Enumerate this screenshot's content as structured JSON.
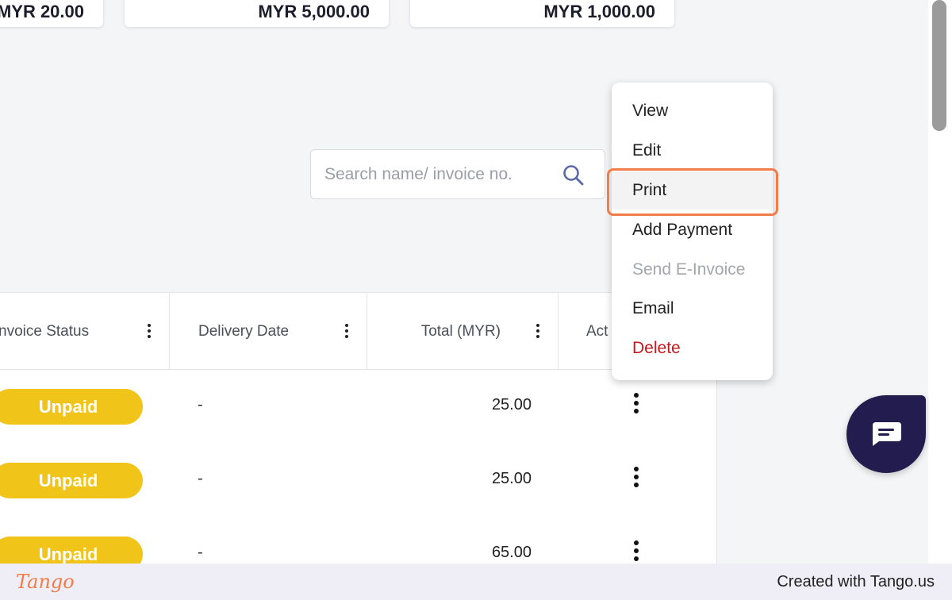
{
  "summary_cards": [
    {
      "amount": "MYR 20.00"
    },
    {
      "amount": "MYR 5,000.00"
    },
    {
      "amount": "MYR 1,000.00"
    }
  ],
  "search": {
    "placeholder": "Search name/ invoice no."
  },
  "table": {
    "columns": [
      {
        "label": "nvoice Status"
      },
      {
        "label": "Delivery Date"
      },
      {
        "label": "Total (MYR)"
      },
      {
        "label": "Act"
      }
    ],
    "rows": [
      {
        "status": "Unpaid",
        "delivery_date": "-",
        "total": "25.00"
      },
      {
        "status": "Unpaid",
        "delivery_date": "-",
        "total": "25.00"
      },
      {
        "status": "Unpaid",
        "delivery_date": "-",
        "total": "65.00"
      }
    ]
  },
  "context_menu": {
    "items": [
      {
        "label": "View",
        "state": "normal"
      },
      {
        "label": "Edit",
        "state": "normal"
      },
      {
        "label": "Print",
        "state": "highlighted"
      },
      {
        "label": "Add Payment",
        "state": "normal"
      },
      {
        "label": "Send E-Invoice",
        "state": "disabled"
      },
      {
        "label": "Email",
        "state": "normal"
      },
      {
        "label": "Delete",
        "state": "danger"
      }
    ]
  },
  "colors": {
    "status_unpaid": "#f0c419",
    "highlight_ring": "#f07d4a",
    "danger": "#c8171d",
    "chat_button": "#221c4f"
  },
  "icons": {
    "search": "search-icon",
    "kebab": "vertical-dots-icon",
    "chat": "chat-bubble-icon"
  },
  "footer": {
    "logo": "Tango",
    "credit": "Created with Tango.us"
  }
}
